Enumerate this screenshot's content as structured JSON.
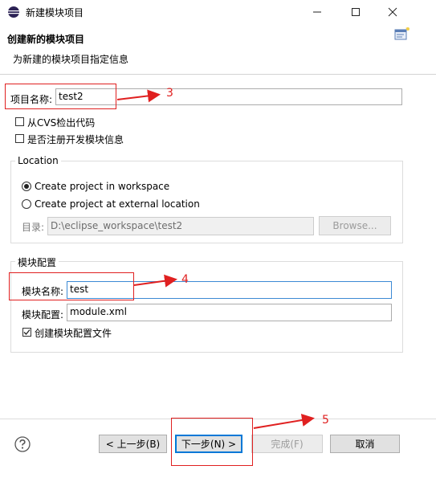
{
  "window": {
    "title": "新建模块项目",
    "controls": [
      "minimize",
      "maximize",
      "close"
    ]
  },
  "header": {
    "title": "创建新的模块项目",
    "description": "为新建的模块项目指定信息"
  },
  "project": {
    "name_label": "项目名称:",
    "name_value": "test2",
    "cvs_checkbox_label": "从CVS检出代码",
    "cvs_checked": false,
    "register_checkbox_label": "是否注册开发模块信息",
    "register_checked": false
  },
  "location": {
    "group_label": "Location",
    "radio_workspace": "Create project in workspace",
    "radio_external": "Create project at external location",
    "selected": "workspace",
    "dir_label": "目录:",
    "dir_value": "D:\\eclipse_workspace\\test2",
    "browse_label": "Browse..."
  },
  "module": {
    "group_label": "模块配置",
    "name_label": "模块名称:",
    "name_value": "test",
    "config_label": "模块配置:",
    "config_value": "module.xml",
    "create_config_label": "创建模块配置文件",
    "create_config_checked": true
  },
  "footer": {
    "back_label": "< 上一步(B)",
    "next_label": "下一步(N) >",
    "finish_label": "完成(F)",
    "cancel_label": "取消"
  },
  "annotations": {
    "step3": "3",
    "step4": "4",
    "step5": "5",
    "color": "#e02020"
  },
  "icons": {
    "app": "eclipse-icon",
    "help": "help-icon",
    "banner": "wizard-banner-icon"
  }
}
